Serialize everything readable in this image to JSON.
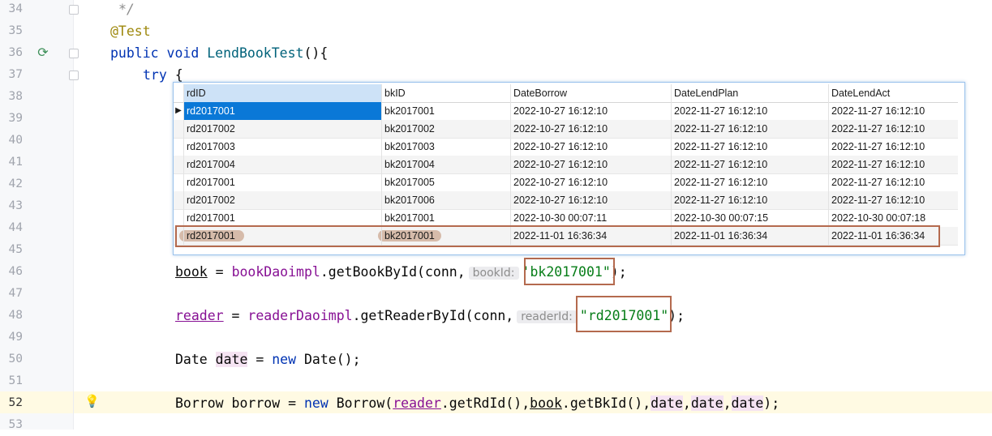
{
  "lines": [
    {
      "num": "34"
    },
    {
      "num": "35"
    },
    {
      "num": "36"
    },
    {
      "num": "37"
    },
    {
      "num": "38"
    },
    {
      "num": "39"
    },
    {
      "num": "40"
    },
    {
      "num": "41"
    },
    {
      "num": "42"
    },
    {
      "num": "43"
    },
    {
      "num": "44"
    },
    {
      "num": "45"
    },
    {
      "num": "46"
    },
    {
      "num": "47"
    },
    {
      "num": "48"
    },
    {
      "num": "49"
    },
    {
      "num": "50"
    },
    {
      "num": "51"
    },
    {
      "num": "52"
    },
    {
      "num": "53"
    }
  ],
  "code": {
    "l34": "*/",
    "l35": "@Test",
    "l36_kw1": "public",
    "l36_kw2": "void",
    "l36_fn": "LendBookTest",
    "l36_rest": "(){",
    "l37_kw": "try",
    "l37_rest": " {",
    "l46_var": "book",
    "l46_eq": " = ",
    "l46_obj": "bookDaoimpl",
    "l46_call": ".getBookById(conn,",
    "l46_hint": "bookId:",
    "l46_str": "'bk2017001\"",
    "l46_end": ");",
    "l48_var": "reader",
    "l48_eq": " = ",
    "l48_obj": "readerDaoimpl",
    "l48_call": ".getReaderById(conn,",
    "l48_hint": "readerId:",
    "l48_str": "\"rd2017001\"",
    "l48_end": ");",
    "l50_type": "Date ",
    "l50_var": "date",
    "l50_eq": " = ",
    "l50_kw": "new",
    "l50_rest": " Date();",
    "l52_type": "Borrow borrow = ",
    "l52_kw": "new",
    "l52_cls": " Borrow(",
    "l52_a1": "reader",
    "l52_a1b": ".getRdId(),",
    "l52_a2": "book",
    "l52_a2b": ".getBkId(),",
    "l52_d1": "date",
    "l52_c1": ",",
    "l52_d2": "date",
    "l52_c2": ",",
    "l52_d3": "date",
    "l52_end": ");"
  },
  "grid": {
    "columns": [
      "rdID",
      "bkID",
      "DateBorrow",
      "DateLendPlan",
      "DateLendAct"
    ],
    "rows": [
      [
        "rd2017001",
        "bk2017001",
        "2022-10-27 16:12:10",
        "2022-11-27 16:12:10",
        "2022-11-27 16:12:10"
      ],
      [
        "rd2017002",
        "bk2017002",
        "2022-10-27 16:12:10",
        "2022-11-27 16:12:10",
        "2022-11-27 16:12:10"
      ],
      [
        "rd2017003",
        "bk2017003",
        "2022-10-27 16:12:10",
        "2022-11-27 16:12:10",
        "2022-11-27 16:12:10"
      ],
      [
        "rd2017004",
        "bk2017004",
        "2022-10-27 16:12:10",
        "2022-11-27 16:12:10",
        "2022-11-27 16:12:10"
      ],
      [
        "rd2017001",
        "bk2017005",
        "2022-10-27 16:12:10",
        "2022-11-27 16:12:10",
        "2022-11-27 16:12:10"
      ],
      [
        "rd2017002",
        "bk2017006",
        "2022-10-27 16:12:10",
        "2022-11-27 16:12:10",
        "2022-11-27 16:12:10"
      ],
      [
        "rd2017001",
        "bk2017001",
        "2022-10-30 00:07:11",
        "2022-10-30 00:07:15",
        "2022-10-30 00:07:18"
      ],
      [
        "rd2017001",
        "bk2017001",
        "2022-11-01 16:36:34",
        "2022-11-01 16:36:34",
        "2022-11-01 16:36:34"
      ]
    ],
    "current_row_marker": "▶"
  },
  "icons": {
    "run": "run-test-icon",
    "bulb": "lightbulb-icon"
  }
}
